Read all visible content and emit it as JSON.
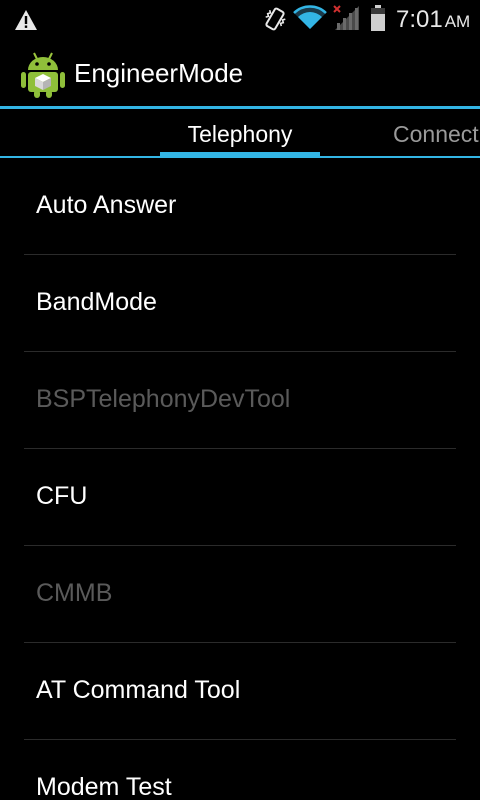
{
  "status_bar": {
    "time": "7:01",
    "ampm": "AM",
    "icons": [
      "warning-icon",
      "vibrate-icon",
      "wifi-icon",
      "signal-icon",
      "battery-icon"
    ]
  },
  "action_bar": {
    "title": "EngineerMode",
    "icon": "android-app-icon"
  },
  "tabs": [
    {
      "label": "Telephony",
      "selected": true
    },
    {
      "label": "Connectivity",
      "selected": false
    }
  ],
  "list": [
    {
      "label": "Auto Answer",
      "enabled": true
    },
    {
      "label": "BandMode",
      "enabled": true
    },
    {
      "label": "BSPTelephonyDevTool",
      "enabled": false
    },
    {
      "label": "CFU",
      "enabled": true
    },
    {
      "label": "CMMB",
      "enabled": false
    },
    {
      "label": "AT Command Tool",
      "enabled": true
    },
    {
      "label": "Modem Test",
      "enabled": true
    }
  ],
  "colors": {
    "accent": "#33b5e5",
    "background": "#000000",
    "text_enabled": "#ffffff",
    "text_disabled": "#5a5a5a"
  }
}
